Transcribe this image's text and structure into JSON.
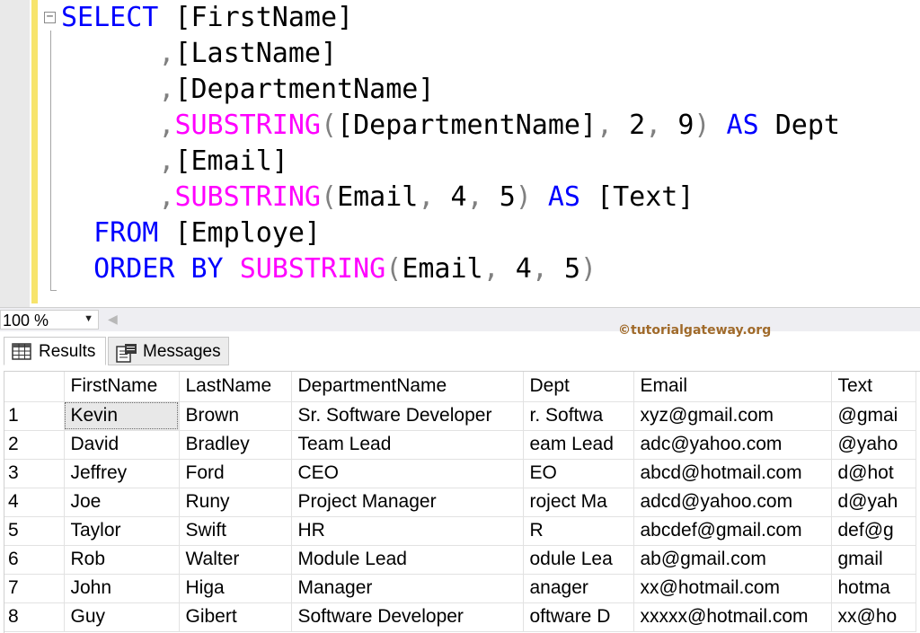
{
  "editor": {
    "sql": {
      "select_kw": "SELECT",
      "col1": "[FirstName]",
      "col2": "[LastName]",
      "col3": "[DepartmentName]",
      "comma": ",",
      "substring_fn": "SUBSTRING",
      "open_paren": "(",
      "close_paren": ")",
      "sub1_arg1": "[DepartmentName]",
      "sub1_arg2": "2",
      "sub1_arg3": "9",
      "as_kw": "AS",
      "alias1": "Dept",
      "col5": "[Email]",
      "sub2_arg1": "Email",
      "sub2_arg2": "4",
      "sub2_arg3": "5",
      "alias2": "[Text]",
      "from_kw": "FROM",
      "table": "[Employe]",
      "order_kw": "ORDER",
      "by_kw": "BY",
      "sub3_arg1": "Email",
      "sub3_arg2": "4",
      "sub3_arg3": "5"
    },
    "colors": {
      "keyword": "#0000ff",
      "function": "#ff00ff",
      "punctuation": "#808080",
      "identifier": "#000000"
    }
  },
  "zoom": {
    "value": "100 %"
  },
  "tabs": {
    "results_label": "Results",
    "messages_label": "Messages"
  },
  "watermark": "©tutorialgateway.org",
  "grid": {
    "columns": [
      "FirstName",
      "LastName",
      "DepartmentName",
      "Dept",
      "Email",
      "Text"
    ],
    "rows": [
      {
        "n": "1",
        "cells": [
          "Kevin",
          "Brown",
          "Sr. Software Developer",
          "r. Softwa",
          "xyz@gmail.com",
          "@gmai"
        ]
      },
      {
        "n": "2",
        "cells": [
          "David",
          "Bradley",
          "Team Lead",
          "eam Lead",
          "adc@yahoo.com",
          "@yaho"
        ]
      },
      {
        "n": "3",
        "cells": [
          "Jeffrey",
          "Ford",
          "CEO",
          "EO",
          "abcd@hotmail.com",
          "d@hot"
        ]
      },
      {
        "n": "4",
        "cells": [
          "Joe",
          "Runy",
          "Project Manager",
          "roject Ma",
          "adcd@yahoo.com",
          "d@yah"
        ]
      },
      {
        "n": "5",
        "cells": [
          "Taylor",
          "Swift",
          "HR",
          "R",
          "abcdef@gmail.com",
          "def@g"
        ]
      },
      {
        "n": "6",
        "cells": [
          "Rob",
          "Walter",
          "Module Lead",
          "odule Lea",
          "ab@gmail.com",
          "gmail"
        ]
      },
      {
        "n": "7",
        "cells": [
          "John",
          "Higa",
          "Manager",
          "anager",
          "xx@hotmail.com",
          "hotma"
        ]
      },
      {
        "n": "8",
        "cells": [
          "Guy",
          "Gibert",
          "Software Developer",
          "oftware D",
          "xxxxx@hotmail.com",
          "xx@ho"
        ]
      }
    ]
  }
}
